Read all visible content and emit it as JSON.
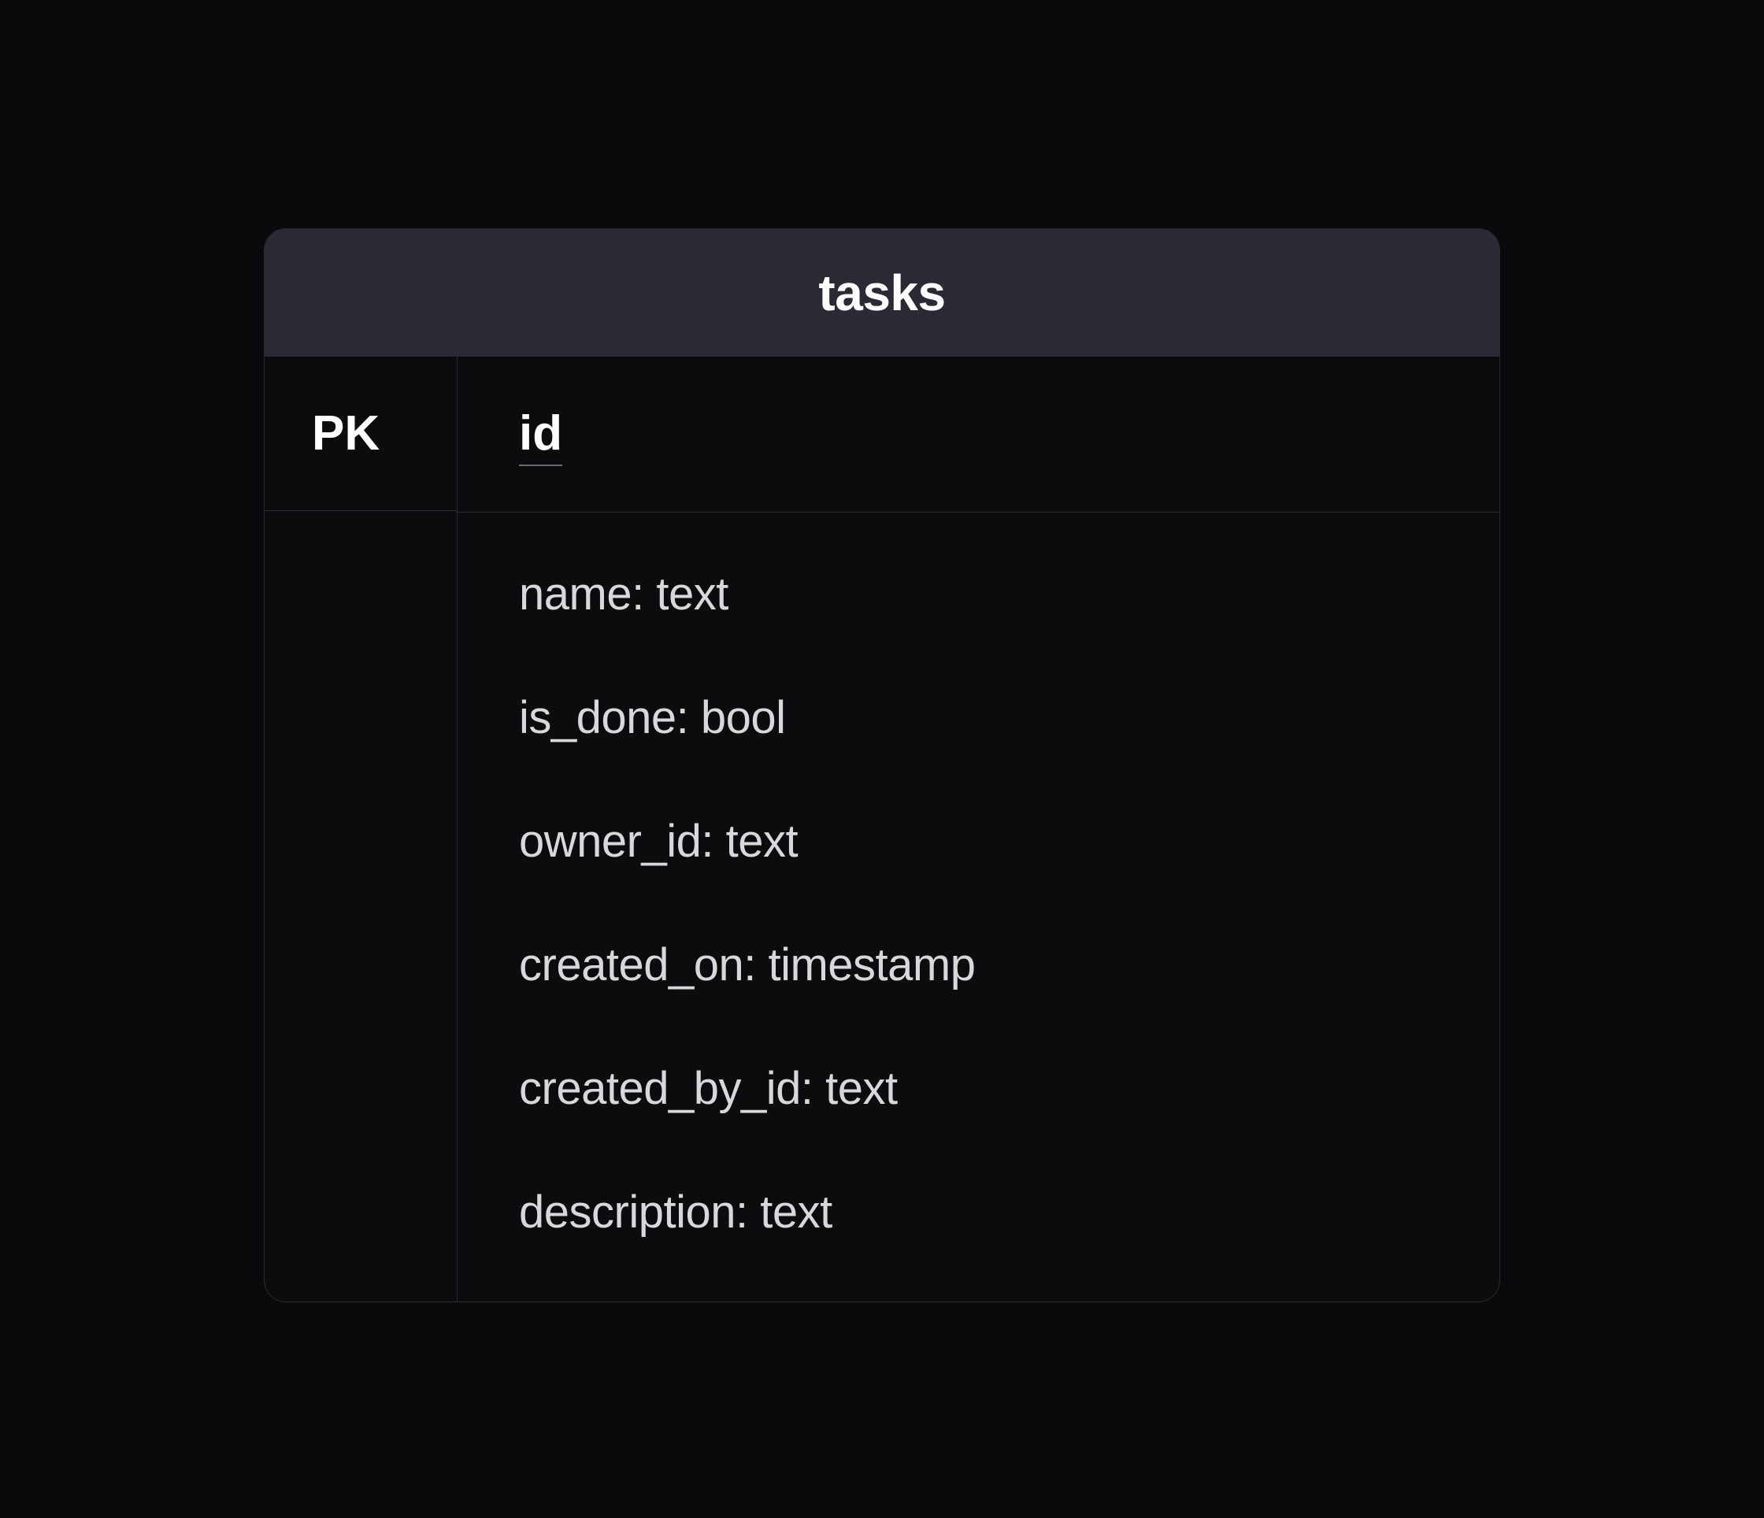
{
  "table": {
    "name": "tasks",
    "primary_key_label": "PK",
    "primary_key_field": "id",
    "fields": [
      {
        "name": "name",
        "type": "text"
      },
      {
        "name": "is_done",
        "type": "bool"
      },
      {
        "name": "owner_id",
        "type": "text"
      },
      {
        "name": "created_on",
        "type": "timestamp"
      },
      {
        "name": "created_by_id",
        "type": "text"
      },
      {
        "name": "description",
        "type": "text"
      }
    ]
  }
}
